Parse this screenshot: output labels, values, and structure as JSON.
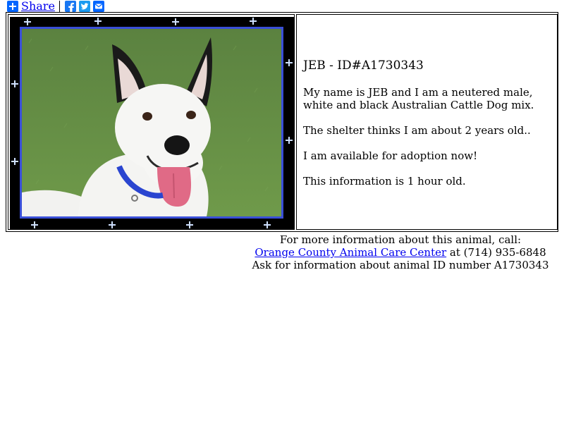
{
  "share": {
    "label": "Share",
    "icons": [
      "addthis-plus-icon",
      "facebook-icon",
      "twitter-icon",
      "email-icon"
    ],
    "colors": {
      "plus": "#0166ff",
      "facebook": "#1877f2",
      "twitter": "#1d9bf0",
      "email": "#0166ff"
    }
  },
  "animal": {
    "title": "JEB - ID#A1730343",
    "paragraphs": [
      "My name is JEB and I am a neutered male, white and black Australian Cattle Dog mix.",
      "The shelter thinks I am about 2 years old..",
      "I am available for adoption now!",
      "This information is 1 hour old."
    ],
    "photo_alt": "white dog with black ears",
    "frame_color": "#000000",
    "photo_border_color": "#3a4fd8"
  },
  "footer": {
    "line1": "For more information about this animal, call:",
    "shelter_link": "Orange County Animal Care Center",
    "phone_text": " at (714) 935-6848",
    "line3": "Ask for information about animal ID number A1730343"
  }
}
